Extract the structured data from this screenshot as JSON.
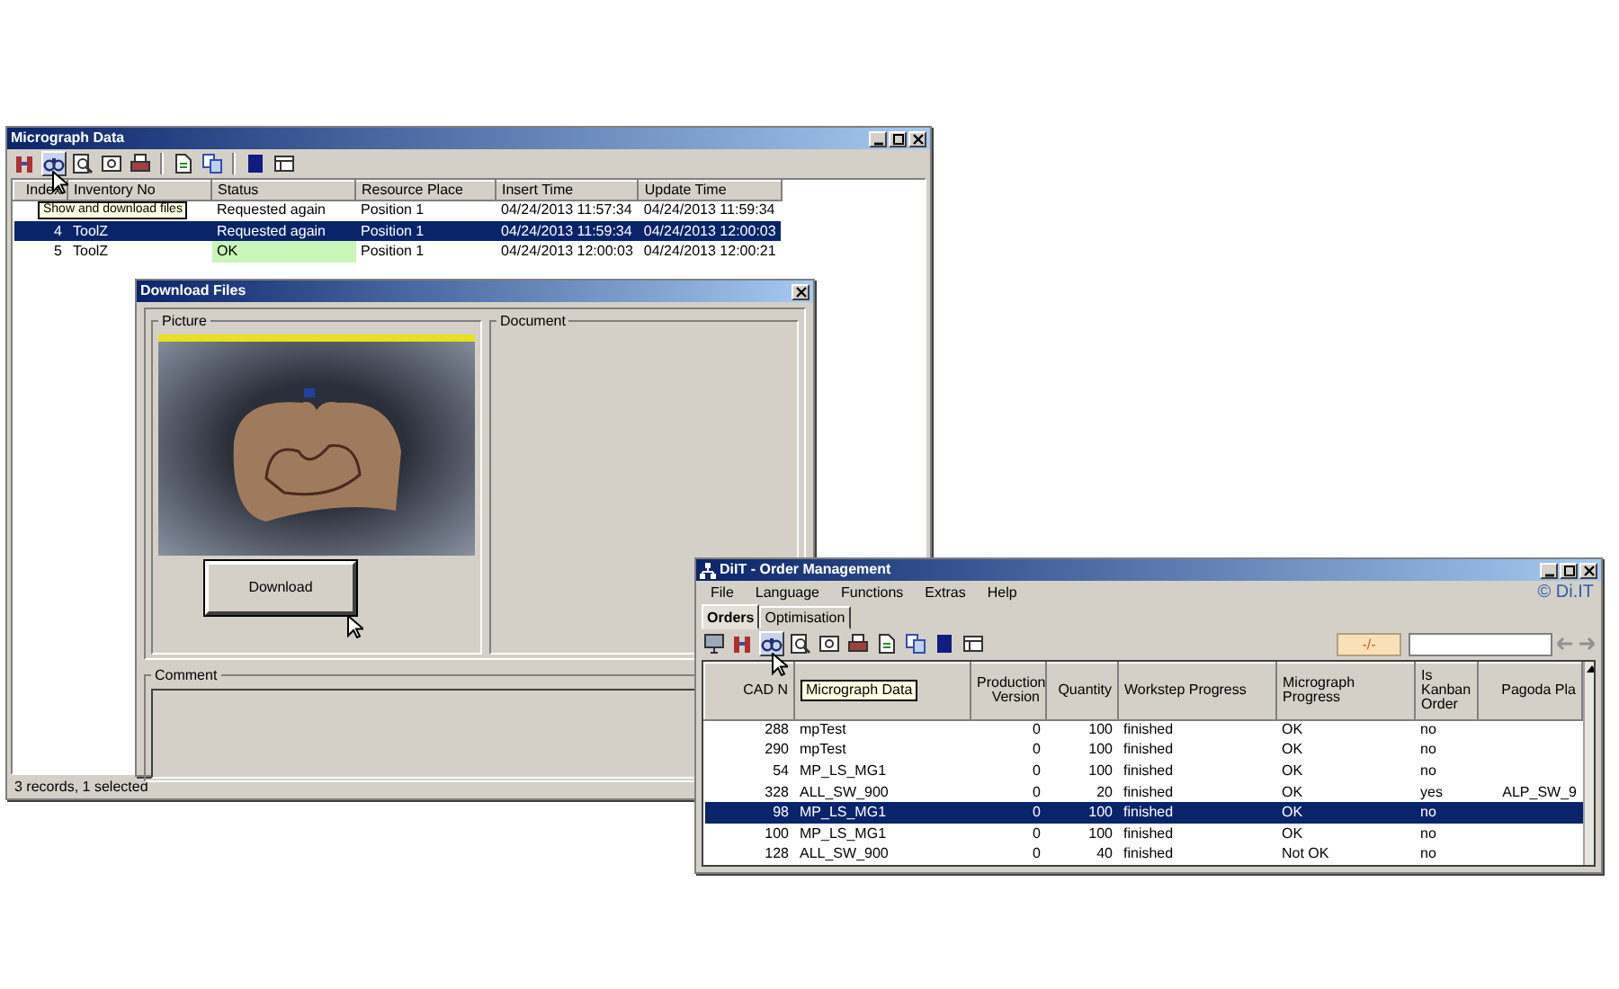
{
  "micrograph_window": {
    "title": "Micrograph Data",
    "toolbar": [
      {
        "kind": "columns",
        "hovered": false
      },
      {
        "kind": "binoculars",
        "hovered": true
      },
      {
        "kind": "magnifier",
        "hovered": false
      },
      {
        "kind": "page-search",
        "hovered": false
      },
      {
        "kind": "printer",
        "hovered": false
      },
      {
        "kind": "separator"
      },
      {
        "kind": "page",
        "hovered": false
      },
      {
        "kind": "copy",
        "hovered": false
      },
      {
        "kind": "separator"
      },
      {
        "kind": "square",
        "hovered": false
      },
      {
        "kind": "table",
        "hovered": false
      }
    ],
    "tooltip": "Show and download files",
    "columns": [
      "Index",
      "Inventory No",
      "Status",
      "Resource Place",
      "Insert Time",
      "Update Time"
    ],
    "rows": [
      {
        "status": "Requested again",
        "resource_place": "Position 1",
        "insert_time": "04/24/2013 11:57:34",
        "update_time": "04/24/2013 11:59:34",
        "selected": false,
        "status_highlighted": false
      },
      {
        "index": "4",
        "inventory_no": "ToolZ",
        "status": "Requested again",
        "resource_place": "Position 1",
        "insert_time": "04/24/2013 11:59:34",
        "update_time": "04/24/2013 12:00:03",
        "selected": true,
        "status_highlighted": false
      },
      {
        "index": "5",
        "inventory_no": "ToolZ",
        "status": "OK",
        "resource_place": "Position 1",
        "insert_time": "04/24/2013 12:00:03",
        "update_time": "04/24/2013 12:00:21",
        "selected": false,
        "status_highlighted": true
      }
    ],
    "status_bar": "3 records, 1 selected"
  },
  "download_window": {
    "title": "Download Files",
    "picture_label": "Picture",
    "download_button": "Download",
    "document_label": "Document",
    "comment_label": "Comment"
  },
  "order_window": {
    "title": "DiIT - Order Management",
    "menu": [
      "File",
      "Language",
      "Functions",
      "Extras",
      "Help"
    ],
    "logo": "© Di.IT",
    "tabs": [
      {
        "label": "Orders",
        "selected": true
      },
      {
        "label": "Optimisation",
        "selected": false
      }
    ],
    "toolbar": [
      {
        "kind": "monitor",
        "hovered": false
      },
      {
        "kind": "columns",
        "hovered": false
      },
      {
        "kind": "binoculars",
        "hovered": true
      },
      {
        "kind": "magnifier",
        "hovered": false
      },
      {
        "kind": "page-search",
        "hovered": false
      },
      {
        "kind": "printer",
        "hovered": false
      },
      {
        "kind": "page",
        "hovered": false
      },
      {
        "kind": "copy",
        "hovered": false
      },
      {
        "kind": "square",
        "hovered": false
      },
      {
        "kind": "table",
        "hovered": false
      }
    ],
    "filter_button": "-/-",
    "tooltip": "Micrograph Data",
    "columns": {
      "cad_no": "CAD N",
      "production_version": "Production Version",
      "quantity": "Quantity",
      "workstep_progress": "Workstep Progress",
      "micrograph_progress": "Micrograph Progress",
      "kanban_order": "Is Kanban Order",
      "pagoda_place": "Pagoda Pla"
    },
    "rows": [
      {
        "cad_no": "288",
        "column_2": "mpTest",
        "production_version": "0",
        "quantity": "100",
        "workstep_progress": "finished",
        "micrograph_progress": "OK",
        "kanban_order": "no",
        "selected": false
      },
      {
        "cad_no": "290",
        "column_2": "mpTest",
        "production_version": "0",
        "quantity": "100",
        "workstep_progress": "finished",
        "micrograph_progress": "OK",
        "kanban_order": "no",
        "selected": false
      },
      {
        "cad_no": "54",
        "column_2": "MP_LS_MG1",
        "production_version": "0",
        "quantity": "100",
        "workstep_progress": "finished",
        "micrograph_progress": "OK",
        "kanban_order": "no",
        "selected": false
      },
      {
        "cad_no": "328",
        "column_2": "ALL_SW_900",
        "production_version": "0",
        "quantity": "20",
        "workstep_progress": "finished",
        "micrograph_progress": "OK",
        "kanban_order": "yes",
        "pagoda_place": "ALP_SW_9",
        "selected": false
      },
      {
        "cad_no": "98",
        "column_2": "MP_LS_MG1",
        "production_version": "0",
        "quantity": "100",
        "workstep_progress": "finished",
        "micrograph_progress": "OK",
        "kanban_order": "no",
        "selected": true
      },
      {
        "cad_no": "100",
        "column_2": "MP_LS_MG1",
        "production_version": "0",
        "quantity": "100",
        "workstep_progress": "finished",
        "micrograph_progress": "OK",
        "kanban_order": "no",
        "selected": false
      },
      {
        "cad_no": "128",
        "column_2": "ALL_SW_900",
        "production_version": "0",
        "quantity": "40",
        "workstep_progress": "finished",
        "micrograph_progress": "Not OK",
        "kanban_order": "no",
        "selected": false
      }
    ]
  }
}
